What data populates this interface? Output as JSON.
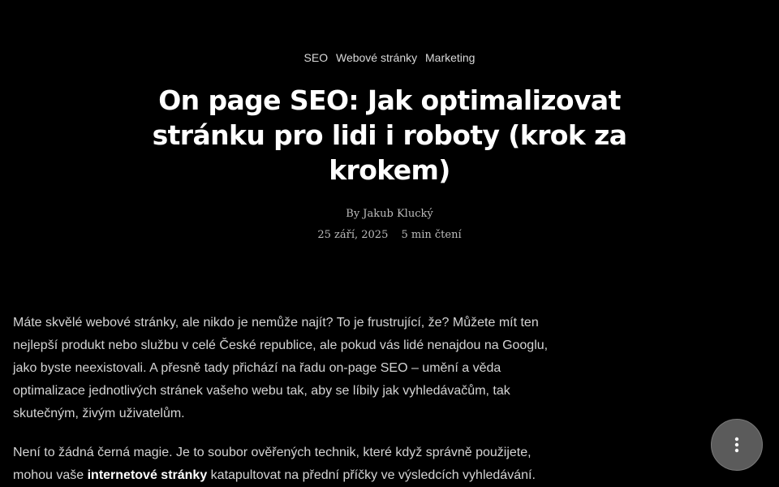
{
  "colors": {
    "background": "#000000",
    "title": "#ffffff",
    "body_text": "#d4d4d4",
    "fab_background": "#5b5b5b"
  },
  "tags": [
    "SEO",
    "Webové stránky",
    "Marketing"
  ],
  "article": {
    "title": "On page SEO: Jak optimalizovat stránku pro lidi i roboty (krok za krokem)",
    "author_line": "By Jakub Klucký",
    "date": "25 září, 2025",
    "read_time": "5 min čtení",
    "paragraph_1": "Máte skvělé webové stránky, ale nikdo je nemůže najít? To je frustrující, že? Můžete mít ten nejlepší produkt nebo službu v celé České republice, ale pokud vás lidé nenajdou na Googlu, jako byste neexistovali. A přesně tady přichází na řadu on-page SEO – umění a věda optimalizace jednotlivých stránek vašeho webu tak, aby se líbily jak vyhledávačům, tak skutečným, živým uživatelům.",
    "paragraph_2_before": "Není to žádná černá magie. Je to soubor ověřených technik, které když správně použijete, mohou vaše ",
    "paragraph_2_bold": "internetové stránky",
    "paragraph_2_after": " katapultovat na přední příčky ve výsledcích vyhledávání."
  },
  "fab": {
    "icon": "vertical-dots-icon"
  }
}
